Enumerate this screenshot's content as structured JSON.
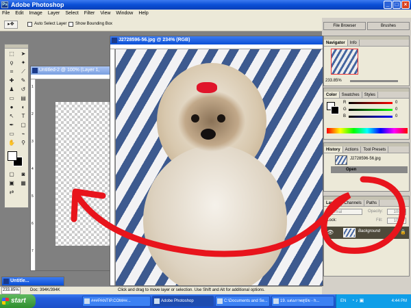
{
  "app": {
    "title": "Adobe Photoshop"
  },
  "menu": [
    "File",
    "Edit",
    "Image",
    "Layer",
    "Select",
    "Filter",
    "View",
    "Window",
    "Help"
  ],
  "options_bar": {
    "auto_select": "Auto Select Layer",
    "bounding_box": "Show Bounding Box"
  },
  "palette_well": [
    "File Browser",
    "Brushes"
  ],
  "untitled_doc": {
    "title": "Untitled-2 @ 100% (Layer 1,",
    "ruler_numbers": [
      "1",
      "2",
      "3",
      "4",
      "5",
      "6",
      "7"
    ]
  },
  "minimized_doc": {
    "title": "Untitle..."
  },
  "main_doc": {
    "title": "J2728596-56.jpg @ 234% (RGB)"
  },
  "navigator": {
    "tabs": [
      "Navigator",
      "Info"
    ],
    "zoom": "233.85%"
  },
  "color": {
    "tabs": [
      "Color",
      "Swatches",
      "Styles"
    ],
    "channels": [
      "R",
      "G",
      "B"
    ],
    "values": [
      "0",
      "0",
      "0"
    ]
  },
  "history": {
    "tabs": [
      "History",
      "Actions",
      "Tool Presets"
    ],
    "snapshot": "J2728596-56.jpg",
    "step": "Open"
  },
  "layers": {
    "tabs": [
      "Layers",
      "Channels",
      "Paths"
    ],
    "blend": "Normal",
    "opacity_label": "Opacity:",
    "opacity": "100%",
    "lock_label": "Lock:",
    "fill_label": "Fill:",
    "fill": "100%",
    "layer_name": "Background"
  },
  "status": {
    "zoom": "233.85%",
    "doc": "Doc: 394K/394K",
    "hint": "Click and drag to move layer or selection. Use Shift and Alt for additional options."
  },
  "taskbar": {
    "start": "start",
    "buttons": [
      "###PANTIP.COM##...",
      "Adobe Photoshop",
      "C:\\Documents and Se...",
      "19. แต่งภาพสุนัข - h..."
    ],
    "lang": "EN",
    "time": "4:44 PM"
  },
  "colors": {
    "accent": "#245edb",
    "annotation": "#e8141c"
  }
}
